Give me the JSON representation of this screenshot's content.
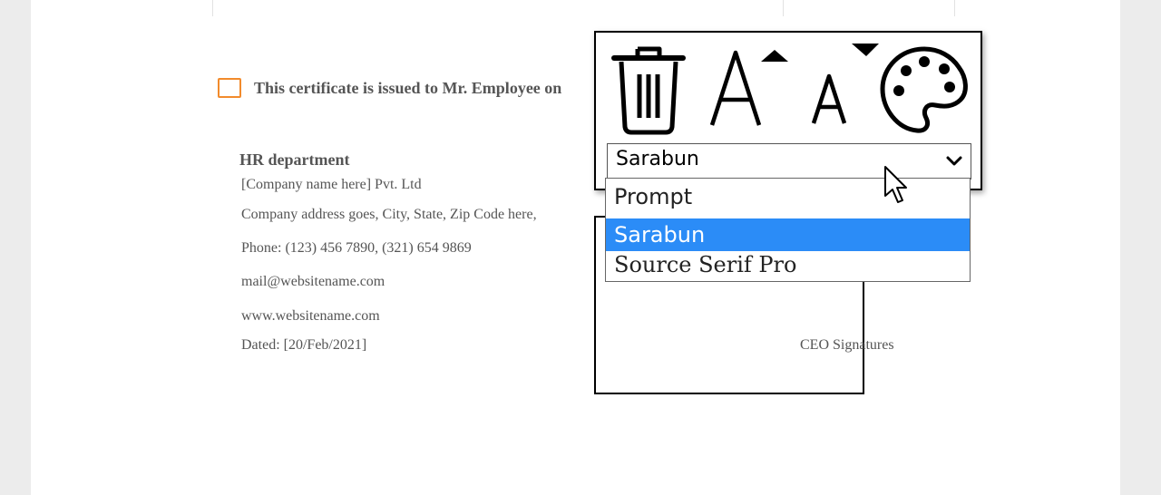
{
  "certificate": {
    "text": "This certificate is issued to Mr. Employee on"
  },
  "hr": {
    "title": "HR department",
    "company": "[Company name here] Pvt. Ltd",
    "address": "Company address goes, City, State, Zip Code  here,",
    "phone": "Phone: (123) 456 7890,  (321) 654 9869",
    "email": "mail@websitename.com",
    "website": "www.websitename.com",
    "dated": "Dated: [20/Feb/2021]"
  },
  "signature": {
    "label": "CEO Signatures"
  },
  "toolbar": {
    "icons": [
      "trash-icon",
      "increase-font-size-icon",
      "decrease-font-size-icon",
      "palette-icon"
    ]
  },
  "font_select": {
    "value": "Sarabun",
    "options": [
      "Prompt",
      "Sarabun",
      "Source Serif Pro"
    ],
    "selected_index": 1,
    "highlight_color": "#2b8cf7"
  },
  "colors": {
    "checkbox_border": "#f28b2c"
  }
}
